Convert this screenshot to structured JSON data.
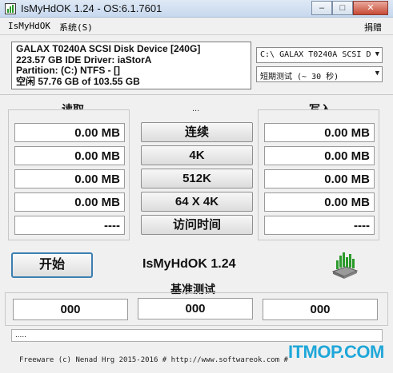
{
  "window": {
    "title": "IsMyHdOK 1.24 - OS:6.1.7601",
    "minimize": "–",
    "maximize": "□",
    "close": "✕"
  },
  "menu": {
    "left_items": [
      "IsMyHdOK",
      "系统(S)"
    ],
    "right_item": "捐赠"
  },
  "info": {
    "line1": "GALAX T0240A SCSI Disk Device [240G]",
    "line2": "223.57 GB  IDE Driver: iaStorA",
    "line3": "Partition: (C:) NTFS - []",
    "line4": "空闲 57.76 GB of 103.55 GB"
  },
  "drive_select": {
    "value": "C:\\  GALAX T0240A SCSI D",
    "arrow": "▼"
  },
  "test_select": {
    "value": "短期测试 (~ 30 秒)",
    "arrow": "▼"
  },
  "read": {
    "header": "读取",
    "values": [
      "0.00 MB",
      "0.00 MB",
      "0.00 MB",
      "0.00 MB",
      "----"
    ]
  },
  "write": {
    "header": "写入",
    "values": [
      "0.00 MB",
      "0.00 MB",
      "0.00 MB",
      "0.00 MB",
      "----"
    ]
  },
  "center": {
    "top_dots": "...",
    "buttons": [
      "连续",
      "4K",
      "512K",
      "64 X 4K",
      "访问时间"
    ]
  },
  "start_button": "开始",
  "brand": "IsMyHdOK 1.24",
  "benchmark": {
    "title": "基准测试",
    "values": [
      "000",
      "000",
      "000"
    ]
  },
  "status_text": ".....",
  "footer": "Freeware (c) Nenad Hrg 2015-2016 # http://www.softwareok.com  #",
  "watermark": "ITMOP.COM",
  "colors": {
    "accent_border": "#3c7fb1",
    "watermark": "#1fa7d9",
    "hdd_green": "#2b9a2b"
  },
  "icons": [
    "app-icon",
    "hdd-icon"
  ]
}
